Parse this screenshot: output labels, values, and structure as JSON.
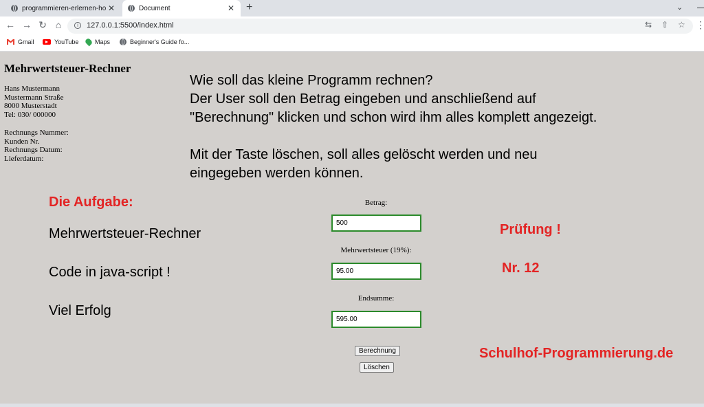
{
  "browser": {
    "tabs": [
      {
        "title": "programmieren-erlernen-how-ca",
        "active": false
      },
      {
        "title": "Document",
        "active": true
      }
    ],
    "new_tab": "+",
    "url": "127.0.0.1:5500/index.html",
    "bookmarks": [
      {
        "label": "Gmail",
        "icon": "gmail-icon"
      },
      {
        "label": "YouTube",
        "icon": "youtube-icon"
      },
      {
        "label": "Maps",
        "icon": "maps-icon"
      },
      {
        "label": "Beginner's Guide fo...",
        "icon": "globe-icon"
      }
    ]
  },
  "page": {
    "title": "Mehrwertsteuer-Rechner",
    "address": [
      "Hans Mustermann",
      "Mustermann Straße",
      "8000 Musterstadt",
      "Tel: 030/ 000000"
    ],
    "invoice": [
      "Rechnungs Nummer:",
      "Kunden Nr.",
      "Rechnungs Datum:",
      "Lieferdatum:"
    ],
    "description": [
      "Wie soll das kleine Programm rechnen?",
      "Der User soll den Betrag eingeben und anschließend auf",
      "\"Berechnung\" klicken und schon wird ihm alles komplett angezeigt.",
      "",
      "Mit der Taste löschen, soll alles gelöscht werden und neu",
      "eingegeben werden können."
    ],
    "task_heading": "Die Aufgabe:",
    "task_lines": [
      "Mehrwertsteuer-Rechner",
      "Code in java-script !",
      "Viel Erfolg"
    ],
    "form": {
      "betrag_label": "Betrag:",
      "betrag_value": "500",
      "mwst_label": "Mehrwertsteuer (19%):",
      "mwst_value": "95.00",
      "summe_label": "Endsumme:",
      "summe_value": "595.00",
      "calc_button": "Berechnung",
      "clear_button": "Löschen"
    },
    "exam_label": "Prüfung !",
    "exam_number": "Nr. 12",
    "site_brand": "Schulhof-Programmierung.de"
  },
  "colors": {
    "accent_red": "#e32424",
    "page_bg": "#d3d0cd",
    "field_border": "#2b8a2b"
  }
}
